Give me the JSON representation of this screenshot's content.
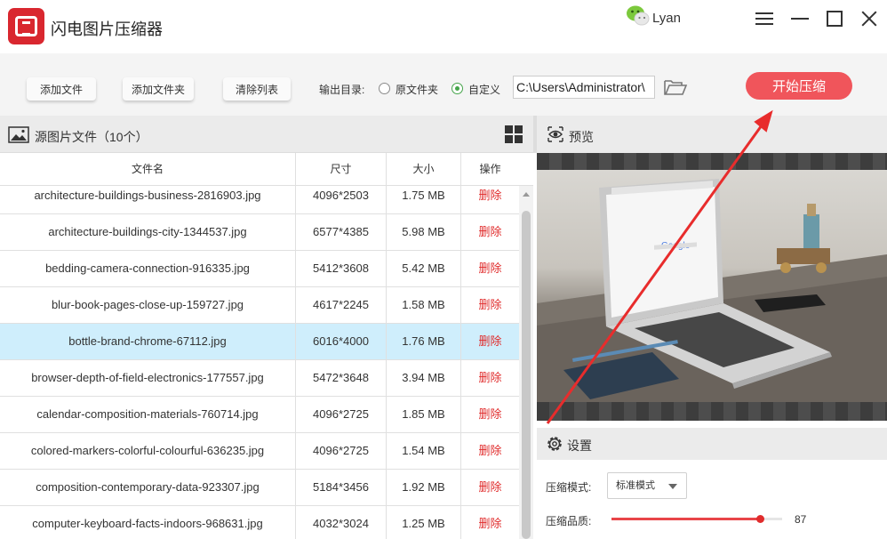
{
  "app": {
    "title": "闪电图片压缩器",
    "user": "Lyan"
  },
  "toolbar": {
    "add_file": "添加文件",
    "add_folder": "添加文件夹",
    "clear_list": "清除列表",
    "output_label": "输出目录:",
    "option_original": "原文件夹",
    "option_custom": "自定义",
    "selected_option": "自定义",
    "output_path": "C:\\Users\\Administrator\\",
    "start_button": "开始压缩"
  },
  "file_panel": {
    "title": "源图片文件（10个）",
    "columns": [
      "文件名",
      "尺寸",
      "大小",
      "操作"
    ],
    "selected_index": 4,
    "rows": [
      {
        "name": "architecture-buildings-business-2816903.jpg",
        "dims": "4096*2503",
        "size": "1.75 MB",
        "action": "删除"
      },
      {
        "name": "architecture-buildings-city-1344537.jpg",
        "dims": "6577*4385",
        "size": "5.98 MB",
        "action": "删除"
      },
      {
        "name": "bedding-camera-connection-916335.jpg",
        "dims": "5412*3608",
        "size": "5.42 MB",
        "action": "删除"
      },
      {
        "name": "blur-book-pages-close-up-159727.jpg",
        "dims": "4617*2245",
        "size": "1.58 MB",
        "action": "删除"
      },
      {
        "name": "bottle-brand-chrome-67112.jpg",
        "dims": "6016*4000",
        "size": "1.76 MB",
        "action": "删除"
      },
      {
        "name": "browser-depth-of-field-electronics-177557.jpg",
        "dims": "5472*3648",
        "size": "3.94 MB",
        "action": "删除"
      },
      {
        "name": "calendar-composition-materials-760714.jpg",
        "dims": "4096*2725",
        "size": "1.85 MB",
        "action": "删除"
      },
      {
        "name": "colored-markers-colorful-colourful-636235.jpg",
        "dims": "4096*2725",
        "size": "1.54 MB",
        "action": "删除"
      },
      {
        "name": "composition-contemporary-data-923307.jpg",
        "dims": "5184*3456",
        "size": "1.92 MB",
        "action": "删除"
      },
      {
        "name": "computer-keyboard-facts-indoors-968631.jpg",
        "dims": "4032*3024",
        "size": "1.25 MB",
        "action": "删除"
      }
    ]
  },
  "preview": {
    "title": "预览",
    "screen_text": "Google"
  },
  "settings": {
    "title": "设置",
    "mode_label": "压缩模式:",
    "mode_value": "标准模式",
    "quality_label": "压缩品质:",
    "quality_value": "87",
    "quality_max": 100
  },
  "colors": {
    "accent": "#f0555b",
    "delete": "#e02c2c",
    "selected_row": "#cfeefc",
    "radio_checked": "#45a44a",
    "annotation_arrow": "#e82c2c"
  },
  "icons": {
    "logo": "app-logo-icon",
    "user": "wechat-icon",
    "folder": "folder-open-icon",
    "picture": "picture-icon",
    "grid": "grid-view-icon",
    "eye": "eye-icon",
    "gear": "gear-icon"
  }
}
